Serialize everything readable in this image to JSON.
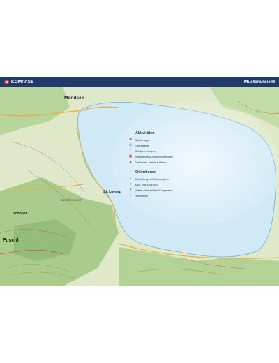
{
  "header": {
    "brand": "KOMPASS",
    "right_label": "Musteransicht"
  },
  "places": {
    "mondsee": "Mondsee",
    "st_lorenz": "St. Lorenz",
    "schober": "Schober",
    "fuschl": "Fuschl",
    "drachenwand": "Drachenwand"
  },
  "legend": {
    "activities": {
      "title": "Aktivitäten",
      "items": [
        {
          "label": "Wanderwege",
          "icon": "hiker-icon",
          "color": "#d23a3a"
        },
        {
          "label": "Fahrradwege",
          "icon": "bicycle-icon",
          "color": "#7a4fb0"
        },
        {
          "label": "Skiloipen & Loipen",
          "icon": "skier-icon",
          "color": "#3a7a3a"
        },
        {
          "label": "Klettersteige & Seilversicherungen",
          "icon": "climbing-icon",
          "color": "#c0392b"
        },
        {
          "label": "Gasthäuser, Hotels & Hütten",
          "icon": "hut-icon",
          "color": "#8a4b1f"
        }
      ]
    },
    "orientation": {
      "title": "Orientieren",
      "items": [
        {
          "label": "Gipfel, Berge & Höhenangaben",
          "icon": "peak-icon",
          "color": "#333333"
        },
        {
          "label": "Bahn, Bus & Straßen",
          "icon": "bus-icon",
          "color": "#333333"
        },
        {
          "label": "Quellen, Wasserfälle & Vegetation",
          "icon": "water-drop-icon",
          "color": "#2d6fb3"
        },
        {
          "label": "Höhenlinien",
          "icon": "contour-icon",
          "color": "#9a7a4a"
        }
      ]
    }
  },
  "colors": {
    "header_bg": "#1f3a6b",
    "lake": "#cfe9f6",
    "land": "#dfe9c9",
    "forest": "#a9cc8c"
  }
}
